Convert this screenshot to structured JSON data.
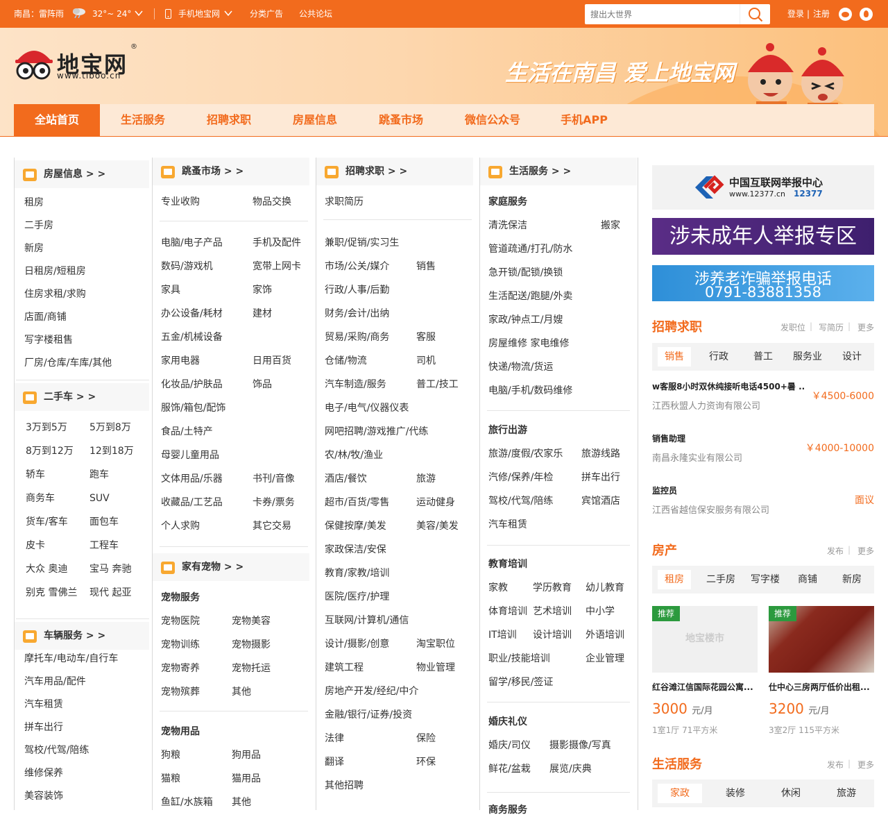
{
  "topbar": {
    "weather": "南昌：雷阵雨",
    "temp": "32°~ 24°",
    "mobile": "手机地宝网",
    "ads": "分类广告",
    "forum": "公共论坛",
    "search_placeholder": "搜出大世界",
    "login": "登录",
    "divider": "|",
    "register": "注册"
  },
  "header": {
    "logo_text": "地宝网",
    "logo_url": "www.tiboo.cn",
    "logo_reg": "®",
    "slogan": "生活在南昌 爱上地宝网"
  },
  "nav": [
    "全站首页",
    "生活服务",
    "招聘求职",
    "房屋信息",
    "跳蚤市场",
    "微信公众号",
    "手机APP"
  ],
  "col1": {
    "house_title": "房屋信息 > >",
    "house_items": [
      "租房",
      "二手房",
      "新房",
      "日租房/短租房",
      "住房求租/求购",
      "店面/商铺",
      "写字楼租售",
      "厂房/仓库/车库/其他"
    ],
    "car_title": "二手车 > >",
    "car_items": [
      [
        "3万到5万",
        "5万到8万"
      ],
      [
        "8万到12万",
        "12到18万"
      ],
      [
        "轿车",
        "跑车"
      ],
      [
        "商务车",
        "SUV"
      ],
      [
        "货车/客车",
        "面包车"
      ],
      [
        "皮卡",
        "工程车"
      ],
      [
        "大众 奥迪",
        "宝马 奔驰"
      ],
      [
        "别克 雪佛兰",
        "现代 起亚"
      ]
    ],
    "vehicle_title": "车辆服务 > >",
    "vehicle_items": [
      "摩托车/电动车/自行车",
      "汽车用品/配件",
      "汽车租赁",
      "拼车出行",
      "驾校/代驾/陪练",
      "维修保养",
      "美容装饰"
    ]
  },
  "col2": {
    "market_title": "跳蚤市场 > >",
    "market_top": [
      "专业收购",
      "物品交换"
    ],
    "market_items": [
      [
        "电脑/电子产品",
        "手机及配件"
      ],
      [
        "数码/游戏机",
        "宽带上网卡"
      ],
      [
        "家具",
        "家饰"
      ],
      [
        "办公设备/耗材",
        "建材"
      ],
      [
        "五金/机械设备",
        ""
      ],
      [
        "家用电器",
        "日用百货"
      ],
      [
        "化妆品/护肤品",
        "饰品"
      ],
      [
        "服饰/箱包/配饰",
        ""
      ],
      [
        "食品/土特产",
        ""
      ],
      [
        "母婴儿童用品",
        ""
      ],
      [
        "文体用品/乐器",
        "书刊/音像"
      ],
      [
        "收藏品/工艺品",
        "卡券/票务"
      ],
      [
        "个人求购",
        "其它交易"
      ]
    ],
    "pet_title": "家有宠物 > >",
    "pet_service_sub": "宠物服务",
    "pet_services": [
      [
        "宠物医院",
        "宠物美容"
      ],
      [
        "宠物训练",
        "宠物摄影"
      ],
      [
        "宠物寄养",
        "宠物托运"
      ],
      [
        "宠物殡葬",
        "其他"
      ]
    ],
    "pet_goods_sub": "宠物用品",
    "pet_goods": [
      [
        "狗粮",
        "狗用品"
      ],
      [
        "猫粮",
        "猫用品"
      ],
      [
        "鱼缸/水族箱",
        "其他"
      ]
    ]
  },
  "col3": {
    "title": "招聘求职 > >",
    "top": "求职简历",
    "items": [
      [
        "兼职/促销/实习生",
        ""
      ],
      [
        "市场/公关/媒介",
        "销售"
      ],
      [
        "行政/人事/后勤",
        ""
      ],
      [
        "财务/会计/出纳",
        ""
      ],
      [
        "贸易/采购/商务",
        "客服"
      ],
      [
        "仓储/物流",
        "司机"
      ],
      [
        "汽车制造/服务",
        "普工/技工"
      ],
      [
        "电子/电气/仪器仪表",
        ""
      ],
      [
        "网吧招聘/游戏推广/代练",
        ""
      ],
      [
        "农/林/牧/渔业",
        ""
      ],
      [
        "酒店/餐饮",
        "旅游"
      ],
      [
        "超市/百货/零售",
        "运动健身"
      ],
      [
        "保健按摩/美发",
        "美容/美发"
      ],
      [
        "家政保洁/安保",
        ""
      ],
      [
        "教育/家教/培训",
        ""
      ],
      [
        "医院/医疗/护理",
        ""
      ],
      [
        "互联网/计算机/通信",
        ""
      ],
      [
        "设计/摄影/创意",
        "淘宝职位"
      ],
      [
        "建筑工程",
        "物业管理"
      ],
      [
        "房地产开发/经纪/中介",
        ""
      ],
      [
        "金融/银行/证券/投资",
        ""
      ],
      [
        "法律",
        "保险"
      ],
      [
        "翻译",
        "环保"
      ],
      [
        "其他招聘",
        ""
      ]
    ]
  },
  "col4": {
    "title": "生活服务 > >",
    "home_sub": "家庭服务",
    "home_items": [
      [
        "清洗保洁",
        "搬家"
      ],
      [
        "管道疏通/打孔/防水",
        ""
      ],
      [
        "急开锁/配锁/换锁",
        ""
      ],
      [
        "生活配送/跑腿/外卖",
        ""
      ],
      [
        "家政/钟点工/月嫂",
        ""
      ],
      [
        "房屋维修 家电维修",
        ""
      ],
      [
        "快递/物流/货运",
        ""
      ],
      [
        "电脑/手机/数码维修",
        ""
      ]
    ],
    "travel_sub": "旅行出游",
    "travel_items": [
      [
        "旅游/度假/农家乐",
        "旅游线路"
      ],
      [
        "汽修/保养/年检",
        "拼车出行"
      ],
      [
        "驾校/代驾/陪练",
        "宾馆酒店"
      ],
      [
        "汽车租赁",
        ""
      ]
    ],
    "edu_sub": "教育培训",
    "edu_items": [
      [
        "家教",
        "学历教育",
        "幼儿教育"
      ],
      [
        "体育培训",
        "艺术培训",
        "中小学"
      ],
      [
        "IT培训",
        "设计培训",
        "外语培训"
      ],
      [
        "职业/技能培训",
        "",
        "企业管理"
      ],
      [
        "留学/移民/签证",
        "",
        ""
      ]
    ],
    "wedding_sub": "婚庆礼仪",
    "wedding_items": [
      [
        "婚庆/司仪",
        "摄影摄像/写真"
      ],
      [
        "鲜花/盆栽",
        "展览/庆典"
      ]
    ],
    "biz_sub": "商务服务"
  },
  "right": {
    "report_center_title": "中国互联网举报中心",
    "report_center_url": "www.12377.cn",
    "report_center_phone": "12377",
    "minor_banner": "涉未成年人举报专区",
    "fraud_banner_line1": "涉养老诈骗举报电话",
    "fraud_banner_line2": "0791-83881358",
    "jobs": {
      "title": "招聘求职",
      "links": [
        "发职位",
        "写简历",
        "更多"
      ],
      "tabs": [
        "销售",
        "行政",
        "普工",
        "服务业",
        "设计"
      ],
      "list": [
        {
          "title": "w客服8小时双休纯接听电话4500+暑 ..",
          "company": "江西秋盟人力资询有限公司",
          "salary": "￥4500-6000"
        },
        {
          "title": "销售助理",
          "company": "南昌永隆实业有限公司",
          "salary": "￥4000-10000"
        },
        {
          "title": "监控员",
          "company": "江西省越信保安服务有限公司",
          "salary": "面议"
        }
      ]
    },
    "house": {
      "title": "房产",
      "links": [
        "发布",
        "更多"
      ],
      "tabs": [
        "租房",
        "二手房",
        "写字楼",
        "商铺",
        "新房"
      ],
      "badge": "推荐",
      "placeholder_text": "地宝楼市",
      "list": [
        {
          "title": "红谷滩江信国际花园公寓...",
          "price": "3000",
          "unit": "元/月",
          "info": "1室1厅 71平方米"
        },
        {
          "title": "仕中心三房两厅低价出租...",
          "price": "3200",
          "unit": "元/月",
          "info": "3室2厅 115平方米"
        }
      ]
    },
    "life": {
      "title": "生活服务",
      "links": [
        "发布",
        "更多"
      ],
      "tabs": [
        "家政",
        "装修",
        "休闲",
        "旅游"
      ]
    }
  }
}
